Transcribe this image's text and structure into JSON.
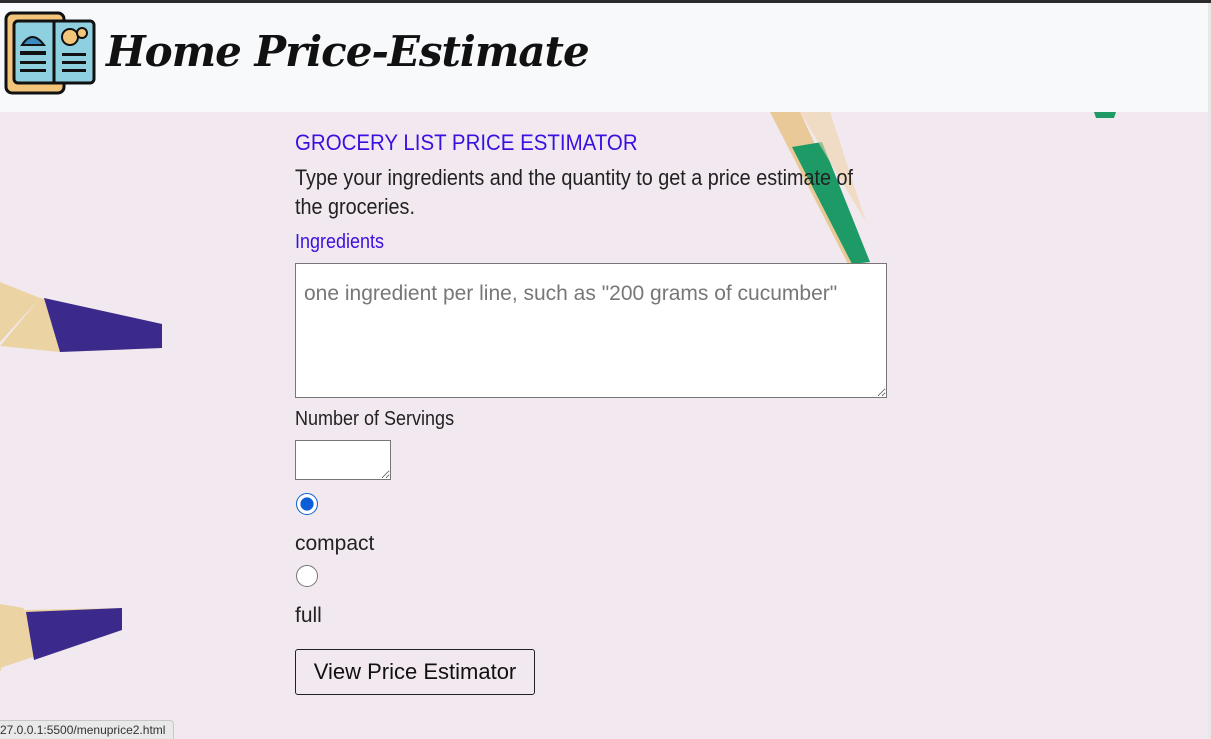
{
  "header": {
    "brand": "Home Price-Estimate",
    "logo_icon": "recipe-book-icon"
  },
  "main": {
    "title": "GROCERY LIST PRICE ESTIMATOR",
    "description": "Type your ingredients and the quantity to get a price estimate of the groceries.",
    "ingredients_label": "Ingredients",
    "ingredients_placeholder": "one ingredient per line, such as \"200 grams of cucumber\"",
    "ingredients_value": "",
    "servings_label": "Number of Servings",
    "servings_value": "",
    "options": [
      {
        "label": "compact",
        "selected": true
      },
      {
        "label": "full",
        "selected": false
      }
    ],
    "submit_label": "View Price Estimator"
  },
  "status_bar": {
    "url": "27.0.0.1:5500/menuprice2.html"
  },
  "colors": {
    "accent": "#3a10e0",
    "navbar_bg": "#f8f9fa",
    "radio_selected": "#0b5ed7",
    "pencil_purple": "#3b2a8c",
    "pencil_green": "#1aa06a"
  }
}
